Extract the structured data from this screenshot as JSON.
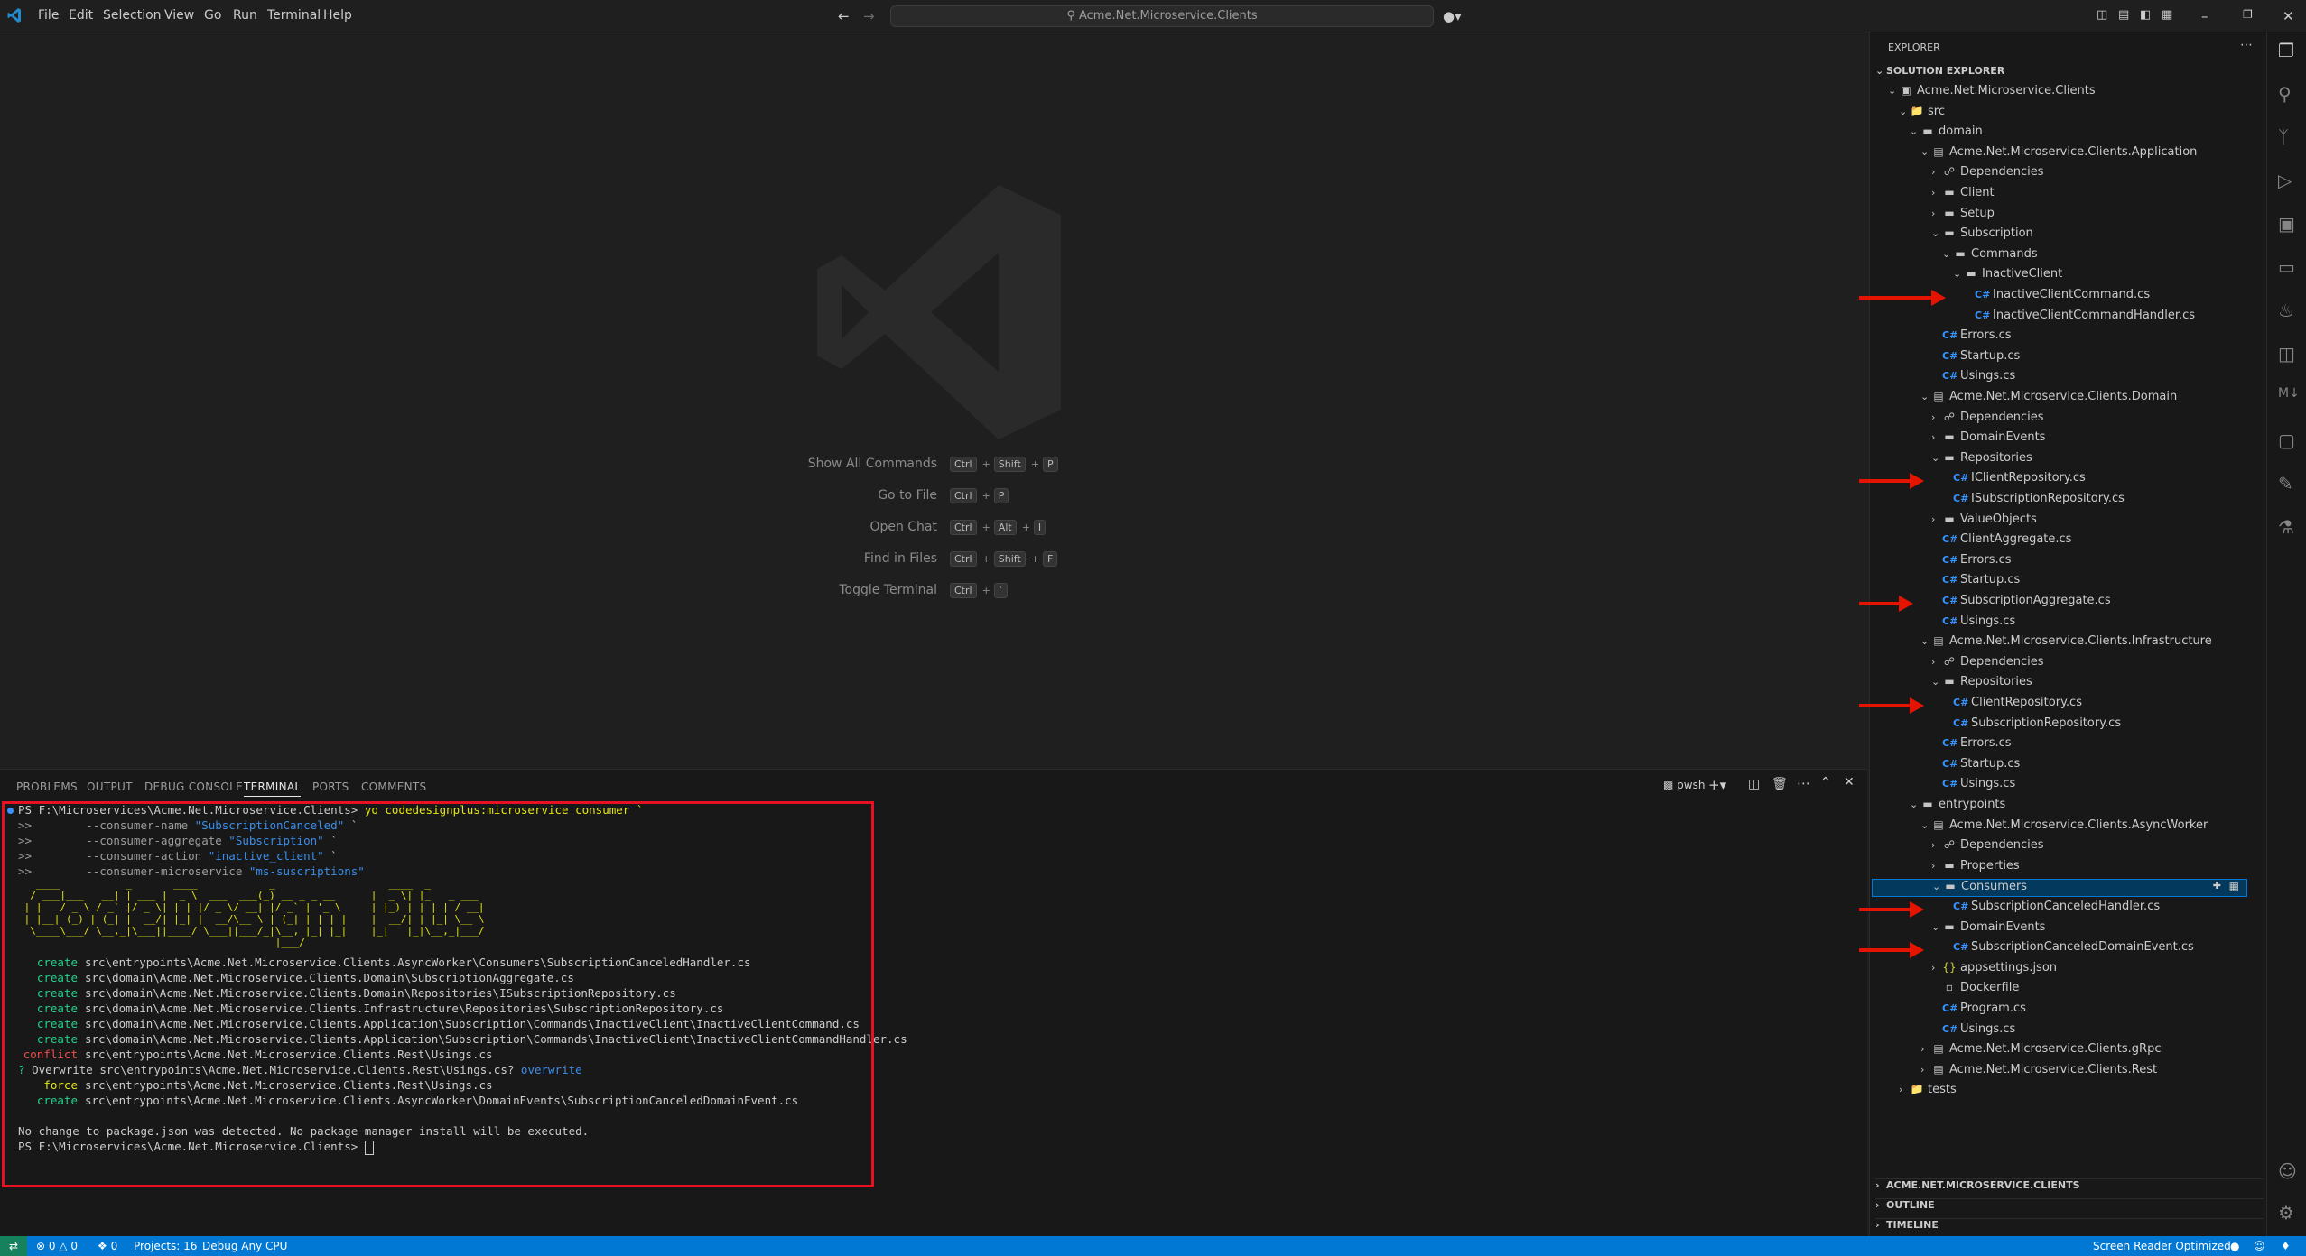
{
  "menu": [
    "File",
    "Edit",
    "Selection",
    "View",
    "Go",
    "Run",
    "Terminal",
    "Help"
  ],
  "search": {
    "text": "Acme.Net.Microservice.Clients"
  },
  "shortcuts": [
    {
      "label": "Show All Commands",
      "keys": [
        "Ctrl",
        "Shift",
        "P"
      ]
    },
    {
      "label": "Go to File",
      "keys": [
        "Ctrl",
        "P"
      ]
    },
    {
      "label": "Open Chat",
      "keys": [
        "Ctrl",
        "Alt",
        "I"
      ]
    },
    {
      "label": "Find in Files",
      "keys": [
        "Ctrl",
        "Shift",
        "F"
      ]
    },
    {
      "label": "Toggle Terminal",
      "keys": [
        "Ctrl",
        "`"
      ]
    }
  ],
  "panel_tabs": [
    "PROBLEMS",
    "OUTPUT",
    "DEBUG CONSOLE",
    "TERMINAL",
    "PORTS",
    "COMMENTS"
  ],
  "terminal_shell": "pwsh",
  "terminal_lines": [
    {
      "prefix": "PS F:\\Microservices\\Acme.Net.Microservice.Clients> ",
      "cmd": "yo codedesignplus:microservice consumer `"
    },
    {
      "prefix": ">>        --consumer-name ",
      "str": "\"SubscriptionCanceled\"",
      "tail": " `"
    },
    {
      "prefix": ">>        --consumer-aggregate ",
      "str": "\"Subscription\"",
      "tail": " `"
    },
    {
      "prefix": ">>        --consumer-action ",
      "str": "\"inactive_client\"",
      "tail": " `"
    },
    {
      "prefix": ">>        --consumer-microservice ",
      "str": "\"ms-suscriptions\"",
      "tail": ""
    }
  ],
  "ascii_art": [
    "   ____           _       ____            _                   ____  _           ",
    "  / ___|___   __| | ___ |  _ \\  ___  ___(_) __ _ _ __      |  _ \\| |_   _ ___ ",
    " | |   / _ \\ / _` |/ _ \\| | | |/ _ \\/ __| |/ _` | '_ \\     | |_) | | | | / __|",
    " | |__| (_) | (_| |  __/| |_| |  __/\\__ \\ | (_| | | | |    |  __/| | |_| \\__ \\",
    "  \\____\\___/ \\__,_|\\___||____/ \\___||___/_|\\__, |_| |_|    |_|   |_|\\__,_|___/",
    "                                           |___/                              "
  ],
  "output_lines": [
    {
      "tag": "create",
      "path": "src\\entrypoints\\Acme.Net.Microservice.Clients.AsyncWorker\\Consumers\\SubscriptionCanceledHandler.cs"
    },
    {
      "tag": "create",
      "path": "src\\domain\\Acme.Net.Microservice.Clients.Domain\\SubscriptionAggregate.cs"
    },
    {
      "tag": "create",
      "path": "src\\domain\\Acme.Net.Microservice.Clients.Domain\\Repositories\\ISubscriptionRepository.cs"
    },
    {
      "tag": "create",
      "path": "src\\domain\\Acme.Net.Microservice.Clients.Infrastructure\\Repositories\\SubscriptionRepository.cs"
    },
    {
      "tag": "create",
      "path": "src\\domain\\Acme.Net.Microservice.Clients.Application\\Subscription\\Commands\\InactiveClient\\InactiveClientCommand.cs"
    },
    {
      "tag": "create",
      "path": "src\\domain\\Acme.Net.Microservice.Clients.Application\\Subscription\\Commands\\InactiveClient\\InactiveClientCommandHandler.cs"
    },
    {
      "tag": "conflict",
      "path": "src\\entrypoints\\Acme.Net.Microservice.Clients.Rest\\Usings.cs"
    }
  ],
  "overwrite_prompt": {
    "q": "? ",
    "text": "Overwrite src\\entrypoints\\Acme.Net.Microservice.Clients.Rest\\Usings.cs? ",
    "answer": "overwrite"
  },
  "force_line": {
    "tag": "force",
    "path": "src\\entrypoints\\Acme.Net.Microservice.Clients.Rest\\Usings.cs"
  },
  "create_last": {
    "tag": "create",
    "path": "src\\entrypoints\\Acme.Net.Microservice.Clients.AsyncWorker\\DomainEvents\\SubscriptionCanceledDomainEvent.cs"
  },
  "info_line": "No change to package.json was detected. No package manager install will be executed.",
  "final_prompt": "PS F:\\Microservices\\Acme.Net.Microservice.Clients> ",
  "explorer": {
    "title": "EXPLORER",
    "section": "SOLUTION EXPLORER",
    "tree": [
      {
        "d": 0,
        "t": "solution",
        "open": true,
        "label": "Acme.Net.Microservice.Clients"
      },
      {
        "d": 1,
        "t": "srcfolder",
        "open": true,
        "label": "src"
      },
      {
        "d": 2,
        "t": "folder",
        "open": true,
        "label": "domain"
      },
      {
        "d": 3,
        "t": "project",
        "open": true,
        "label": "Acme.Net.Microservice.Clients.Application"
      },
      {
        "d": 4,
        "t": "deps",
        "open": false,
        "label": "Dependencies"
      },
      {
        "d": 4,
        "t": "folder",
        "open": false,
        "label": "Client"
      },
      {
        "d": 4,
        "t": "folder",
        "open": false,
        "label": "Setup"
      },
      {
        "d": 4,
        "t": "folder",
        "open": true,
        "label": "Subscription"
      },
      {
        "d": 5,
        "t": "folder",
        "open": true,
        "label": "Commands"
      },
      {
        "d": 6,
        "t": "folder",
        "open": true,
        "label": "InactiveClient"
      },
      {
        "d": 7,
        "t": "cs",
        "label": "InactiveClientCommand.cs",
        "arrow": true
      },
      {
        "d": 7,
        "t": "cs",
        "label": "InactiveClientCommandHandler.cs"
      },
      {
        "d": 4,
        "t": "cs",
        "label": "Errors.cs"
      },
      {
        "d": 4,
        "t": "cs",
        "label": "Startup.cs"
      },
      {
        "d": 4,
        "t": "cs",
        "label": "Usings.cs"
      },
      {
        "d": 3,
        "t": "project",
        "open": true,
        "label": "Acme.Net.Microservice.Clients.Domain"
      },
      {
        "d": 4,
        "t": "deps",
        "open": false,
        "label": "Dependencies"
      },
      {
        "d": 4,
        "t": "folder",
        "open": false,
        "label": "DomainEvents"
      },
      {
        "d": 4,
        "t": "folder",
        "open": true,
        "label": "Repositories"
      },
      {
        "d": 5,
        "t": "cs",
        "label": "IClientRepository.cs",
        "arrow": true
      },
      {
        "d": 5,
        "t": "cs",
        "label": "ISubscriptionRepository.cs"
      },
      {
        "d": 4,
        "t": "folder",
        "open": false,
        "label": "ValueObjects"
      },
      {
        "d": 4,
        "t": "cs",
        "label": "ClientAggregate.cs"
      },
      {
        "d": 4,
        "t": "cs",
        "label": "Errors.cs"
      },
      {
        "d": 4,
        "t": "cs",
        "label": "Startup.cs"
      },
      {
        "d": 4,
        "t": "cs",
        "label": "SubscriptionAggregate.cs",
        "arrow": true
      },
      {
        "d": 4,
        "t": "cs",
        "label": "Usings.cs"
      },
      {
        "d": 3,
        "t": "project",
        "open": true,
        "label": "Acme.Net.Microservice.Clients.Infrastructure"
      },
      {
        "d": 4,
        "t": "deps",
        "open": false,
        "label": "Dependencies"
      },
      {
        "d": 4,
        "t": "folder",
        "open": true,
        "label": "Repositories"
      },
      {
        "d": 5,
        "t": "cs",
        "label": "ClientRepository.cs",
        "arrow": true
      },
      {
        "d": 5,
        "t": "cs",
        "label": "SubscriptionRepository.cs"
      },
      {
        "d": 4,
        "t": "cs",
        "label": "Errors.cs"
      },
      {
        "d": 4,
        "t": "cs",
        "label": "Startup.cs"
      },
      {
        "d": 4,
        "t": "cs",
        "label": "Usings.cs"
      },
      {
        "d": 2,
        "t": "folder",
        "open": true,
        "label": "entrypoints"
      },
      {
        "d": 3,
        "t": "project",
        "open": true,
        "label": "Acme.Net.Microservice.Clients.AsyncWorker"
      },
      {
        "d": 4,
        "t": "deps",
        "open": false,
        "label": "Dependencies"
      },
      {
        "d": 4,
        "t": "folder",
        "open": false,
        "label": "Properties"
      },
      {
        "d": 4,
        "t": "folder",
        "open": true,
        "label": "Consumers",
        "selected": true
      },
      {
        "d": 5,
        "t": "cs",
        "label": "SubscriptionCanceledHandler.cs",
        "arrow": true
      },
      {
        "d": 4,
        "t": "folder",
        "open": true,
        "label": "DomainEvents"
      },
      {
        "d": 5,
        "t": "cs",
        "label": "SubscriptionCanceledDomainEvent.cs",
        "arrow": true
      },
      {
        "d": 4,
        "t": "json",
        "open": false,
        "label": "appsettings.json"
      },
      {
        "d": 4,
        "t": "file",
        "label": "Dockerfile"
      },
      {
        "d": 4,
        "t": "cs",
        "label": "Program.cs"
      },
      {
        "d": 4,
        "t": "cs",
        "label": "Usings.cs"
      },
      {
        "d": 3,
        "t": "project",
        "open": false,
        "label": "Acme.Net.Microservice.Clients.gRpc"
      },
      {
        "d": 3,
        "t": "project",
        "open": false,
        "label": "Acme.Net.Microservice.Clients.Rest"
      },
      {
        "d": 1,
        "t": "testfolder",
        "open": false,
        "label": "tests"
      }
    ],
    "bottom_sections": [
      "ACME.NET.MICROSERVICE.CLIENTS",
      "OUTLINE",
      "TIMELINE"
    ]
  },
  "statusbar": {
    "errors": "0",
    "warnings": "0",
    "ports": "0",
    "projects": "Projects: 16",
    "debug": "Debug Any CPU",
    "screen_reader": "Screen Reader Optimized"
  },
  "colors": {
    "accent": "#0078d4",
    "annotation": "#e51400",
    "cs_icon": "#3794ff"
  }
}
